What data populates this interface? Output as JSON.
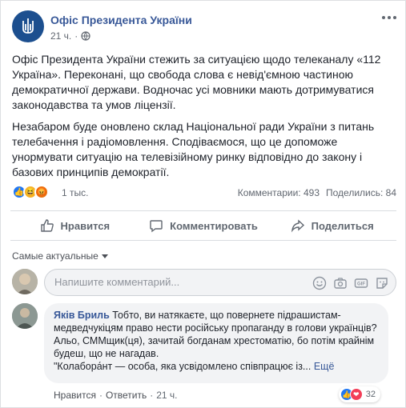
{
  "post": {
    "page_name": "Офіс Президента України",
    "time": "21 ч.",
    "separator": "·",
    "paragraph1": "Офіс Президента України стежить за ситуацією щодо телеканалу «112 Україна». Переконані, що свобода слова є невід'ємною частиною демократичної держави. Водночас усі мовники мають дотримуватися законодавства та умов ліцензії.",
    "paragraph2": "Незабаром буде оновлено склад Національної ради України з питань телебачення і радіомовлення. Сподіваємося, що це допоможе унормувати ситуацію на телевізійному ринку відповідно до закону і базових принципів демократії.",
    "reaction_count": "1 тыс.",
    "comments_count": "Комментарии: 493",
    "shares_count": "Поделились: 84"
  },
  "actions": {
    "like": "Нравится",
    "comment": "Комментировать",
    "share": "Поделиться"
  },
  "comments_filter": "Самые актуальные",
  "composer": {
    "placeholder": "Напишите комментарий..."
  },
  "comment": {
    "author": "Яків Бриль",
    "text_line1": "Тобто, ви натякаєте, що повернете підрашистам-медведчукіцям право нести російську пропаганду в голови українців?",
    "text_line2": "Альо, СММщик(ця), зачитай богданам хрестоматію, бо потім крайнім будеш, що не нагадав.",
    "text_line3": "\"Колабора́нт — особа, яка усвідомлено співпрацює із...",
    "more": "Ещё",
    "like_label": "Нравится",
    "reply_label": "Ответить",
    "time": "21 ч.",
    "dot": "·",
    "reaction_count": "32"
  },
  "colors": {
    "link": "#385898",
    "like_blue": "#2078f4",
    "border": "#dadde1"
  },
  "icons": [
    "trident-logo-icon",
    "globe-icon",
    "more-options-icon",
    "like-icon",
    "comment-icon",
    "share-icon",
    "emoji-icon",
    "camera-icon",
    "gif-icon",
    "sticker-icon"
  ]
}
